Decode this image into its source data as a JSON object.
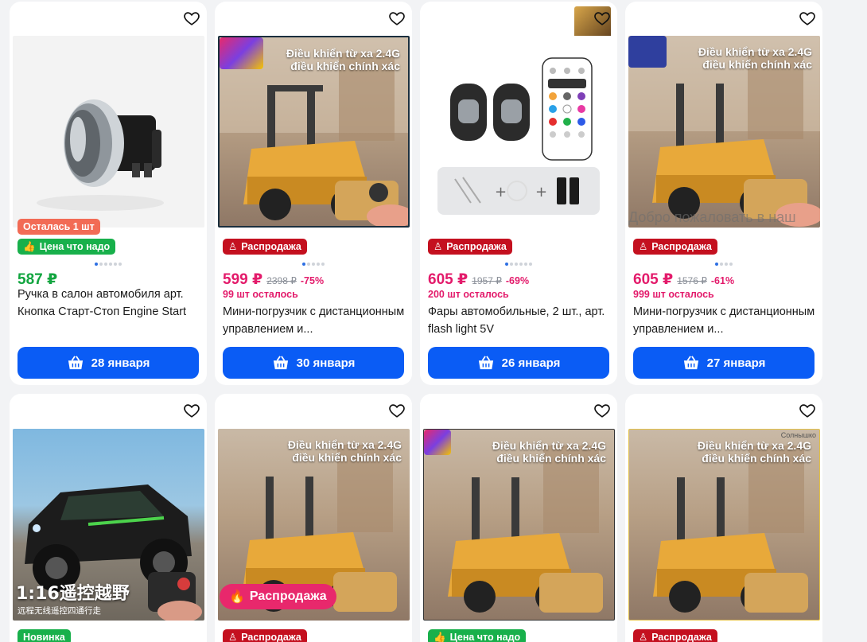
{
  "accent_color": "#0a5cf5",
  "sale_color": "#c4101f",
  "price_color": "#e31b6b",
  "cards": [
    {
      "badge_left": "Осталась 1 шт",
      "badge_good": "Цена что надо",
      "price": "587 ₽",
      "title": "Ручка в салон автомобиля арт. Кнопка Старт-Стоп Engine Start",
      "delivery": "28 января"
    },
    {
      "overlay_text_1": "Điều khiển từ xa 2.4G",
      "overlay_text_2": "điều khiển chính xác",
      "badge_sale": "Распродажа",
      "price": "599 ₽",
      "old_price": "2398 ₽",
      "discount": "-75%",
      "stock": "99 шт осталось",
      "title": "Мини-погрузчик с дистанционным управлением и...",
      "delivery": "30 января"
    },
    {
      "badge_sale": "Распродажа",
      "price": "605 ₽",
      "old_price": "1957 ₽",
      "discount": "-69%",
      "stock": "200 шт осталось",
      "title": "Фары автомобильные, 2 шт., арт. flash light 5V",
      "delivery": "26 января"
    },
    {
      "overlay_text_1": "Điều khiển từ xa 2.4G",
      "overlay_text_2": "điều khiển chính xác",
      "watermark": "Добро пожаловать в наш",
      "badge_sale": "Распродажа",
      "price": "605 ₽",
      "old_price": "1576 ₽",
      "discount": "-61%",
      "stock": "999 шт осталось",
      "title": "Мини-погрузчик с дистанционным управлением и...",
      "delivery": "27 января"
    },
    {
      "cn_title": "1:16遥控越野",
      "cn_sub": "远程无线遥控四通行走",
      "badge_new": "Новинка"
    },
    {
      "overlay_text_1": "Điều khiển từ xa 2.4G",
      "overlay_text_2": "điều khiển chính xác",
      "image_sale": "Распродажа",
      "badge_sale": "Распродажа"
    },
    {
      "overlay_text_1": "Điều khiển từ xa 2.4G",
      "overlay_text_2": "điều khiển chính xác",
      "badge_good": "Цена что надо"
    },
    {
      "overlay_text_1": "Điều khiển từ xa 2.4G",
      "overlay_text_2": "điều khiển chính xác",
      "shop_tag": "Солнышко",
      "badge_sale": "Распродажа"
    }
  ]
}
